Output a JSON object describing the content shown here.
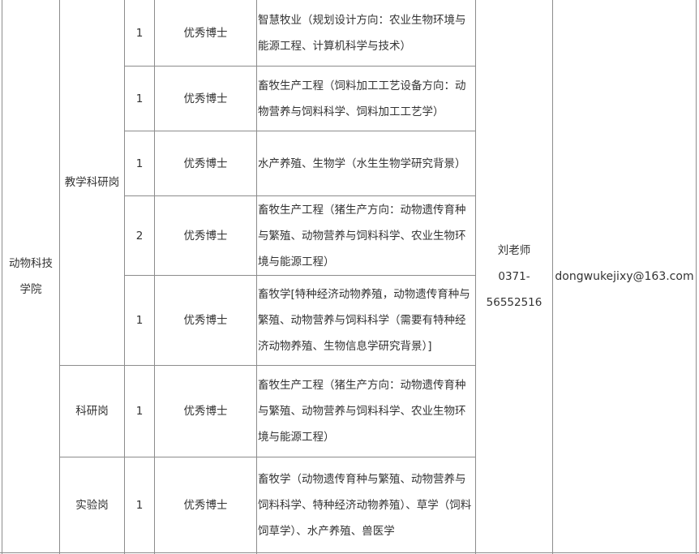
{
  "department": "动物科技学院",
  "contact_name": "刘老师",
  "contact_phone_a": "0371-",
  "contact_phone_b": "56552516",
  "email": "dongwukejixy@163.com",
  "posts": [
    "教学科研岗",
    "科研岗",
    "实验岗"
  ],
  "rows": [
    {
      "count": "1",
      "type": "优秀博士",
      "major": "智慧牧业（规划设计方向：农业生物环境与能源工程、计算机科学与技术）"
    },
    {
      "count": "1",
      "type": "优秀博士",
      "major": "畜牧生产工程（饲料加工工艺设备方向：动物营养与饲料科学、饲料加工工艺学）"
    },
    {
      "count": "1",
      "type": "优秀博士",
      "major": "水产养殖、生物学（水生生物学研究背景）"
    },
    {
      "count": "2",
      "type": "优秀博士",
      "major": "畜牧生产工程（猪生产方向：动物遗传育种与繁殖、动物营养与饲料科学、农业生物环境与能源工程）"
    },
    {
      "count": "1",
      "type": "优秀博士",
      "major": "畜牧学[特种经济动物养殖，动物遗传育种与繁殖、动物营养与饲料科学（需要有特种经济动物养殖、生物信息学研究背景）]"
    },
    {
      "count": "1",
      "type": "优秀博士",
      "major": "畜牧生产工程（猪生产方向：动物遗传育种与繁殖、动物营养与饲料科学、农业生物环境与能源工程）"
    },
    {
      "count": "1",
      "type": "优秀博士",
      "major": "畜牧学（动物遗传育种与繁殖、动物营养与饲料科学、特种经济动物养殖）、草学（饲料饲草学）、水产养殖、兽医学"
    }
  ]
}
